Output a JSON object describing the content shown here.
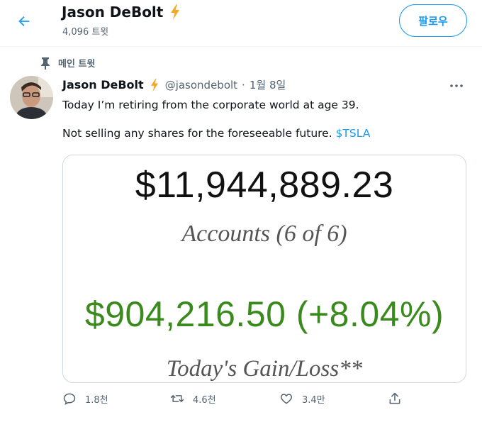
{
  "header": {
    "name": "Jason DeBolt",
    "tweet_count": "4,096 트윗",
    "follow_label": "팔로우"
  },
  "pinned_label": "메인 트윗",
  "tweet": {
    "name": "Jason DeBolt",
    "handle": "@jasondebolt",
    "separator": "·",
    "date": "1월 8일",
    "line1": "Today I’m retiring from the corporate world at age 39.",
    "line2_text": "Not selling any shares for the foreseeable future. ",
    "cashtag": "$TSLA"
  },
  "media": {
    "total": "$11,944,889.23",
    "accounts": "Accounts (6 of 6)",
    "gain": "$904,216.50 (+8.04%)",
    "today": "Today's Gain/Loss**"
  },
  "actions": {
    "replies": "1.8천",
    "retweets": "4.6천",
    "likes": "3.4만"
  },
  "colors": {
    "accent": "#1d9bf0",
    "muted": "#536471",
    "gain_green": "#3a8a1e",
    "lightning": "#f5a623"
  },
  "icons": [
    "back-arrow-icon",
    "lightning-icon",
    "pin-icon",
    "more-icon",
    "reply-icon",
    "retweet-icon",
    "like-icon",
    "share-icon"
  ]
}
